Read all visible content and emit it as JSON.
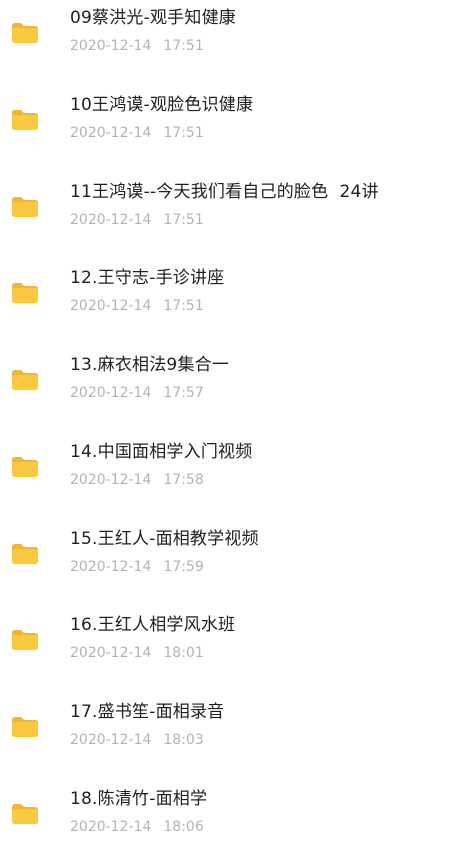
{
  "folder_color": "#F9C941",
  "folder_tab_color": "#F0B72E",
  "files": [
    {
      "name": "09蔡洪光-观手知健康",
      "date": "2020-12-14",
      "time": "17:51",
      "icon": "folder-icon"
    },
    {
      "name": "10王鸿谟-观脸色识健康",
      "date": "2020-12-14",
      "time": "17:51",
      "icon": "folder-icon"
    },
    {
      "name": "11王鸿谟--今天我们看自己的脸色  24讲",
      "date": "2020-12-14",
      "time": "17:51",
      "icon": "folder-icon"
    },
    {
      "name": "12.王守志-手诊讲座",
      "date": "2020-12-14",
      "time": "17:51",
      "icon": "folder-icon"
    },
    {
      "name": "13.麻衣相法9集合一",
      "date": "2020-12-14",
      "time": "17:57",
      "icon": "folder-icon"
    },
    {
      "name": "14.中国面相学入门视频",
      "date": "2020-12-14",
      "time": "17:58",
      "icon": "folder-icon"
    },
    {
      "name": "15.王红人-面相教学视频",
      "date": "2020-12-14",
      "time": "17:59",
      "icon": "folder-icon"
    },
    {
      "name": "16.王红人相学风水班",
      "date": "2020-12-14",
      "time": "18:01",
      "icon": "folder-icon"
    },
    {
      "name": "17.盛书笙-面相录音",
      "date": "2020-12-14",
      "time": "18:03",
      "icon": "folder-icon"
    },
    {
      "name": "18.陈清竹-面相学",
      "date": "2020-12-14",
      "time": "18:06",
      "icon": "folder-icon"
    }
  ]
}
